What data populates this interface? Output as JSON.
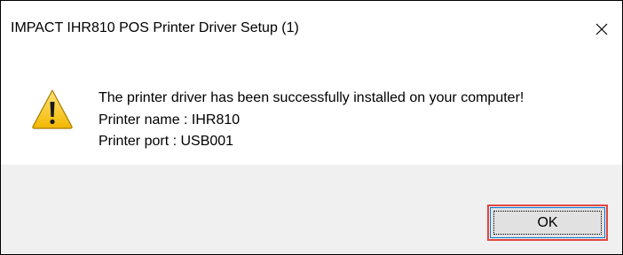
{
  "window": {
    "title": "IMPACT IHR810 POS Printer Driver Setup (1)",
    "close_icon": "close-icon"
  },
  "message": {
    "icon": "warning-icon",
    "line1": "The printer driver has been successfully installed on your computer!",
    "line2": "Printer name : IHR810",
    "line3": "Printer port : USB001"
  },
  "buttons": {
    "ok_label": "OK"
  },
  "colors": {
    "highlight": "#e0473c",
    "button_border": "#0078d7",
    "footer_bg": "#f0f0f0",
    "warning_yellow": "#f2c200"
  }
}
